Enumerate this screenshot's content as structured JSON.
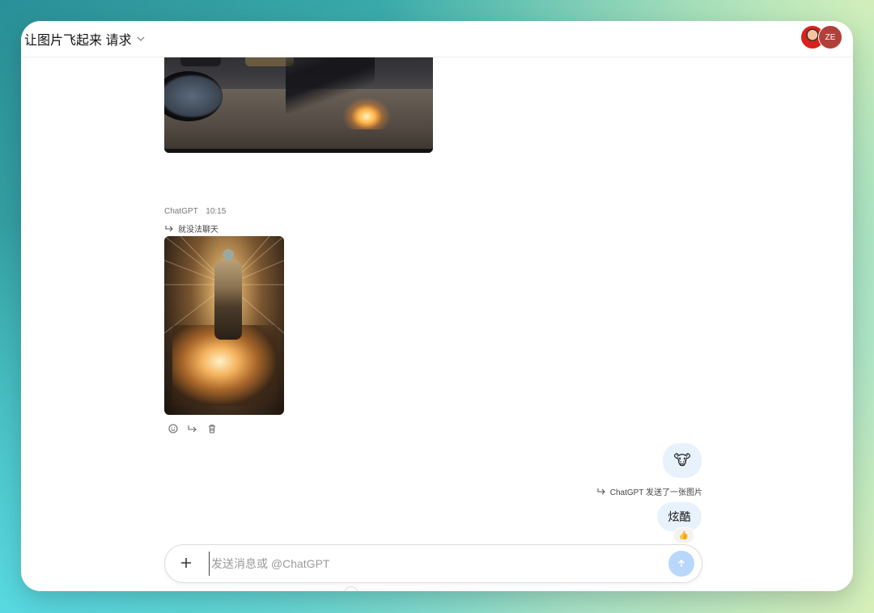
{
  "window": {
    "title": "让图片飞起来 请求",
    "avatar_initials": "ZE"
  },
  "message_chatgpt": {
    "sender": "ChatGPT",
    "time": "10:15",
    "reply_to": "就没法聊天"
  },
  "message_user": {
    "emoji": "🐮",
    "reply_to": "ChatGPT 发送了一张图片",
    "text": "炫酷",
    "reaction": "👍"
  },
  "composer": {
    "placeholder": "发送消息或 @ChatGPT"
  },
  "colors": {
    "bubble_bg": "#e8f2fd",
    "send_button": "#b9d7fb",
    "avatar_ze": "#b1403a"
  },
  "icons": [
    "chevron-down-icon",
    "reply-arrow-icon",
    "emoji-add-icon",
    "forward-icon",
    "trash-icon",
    "plus-icon",
    "send-arrow-icon"
  ]
}
